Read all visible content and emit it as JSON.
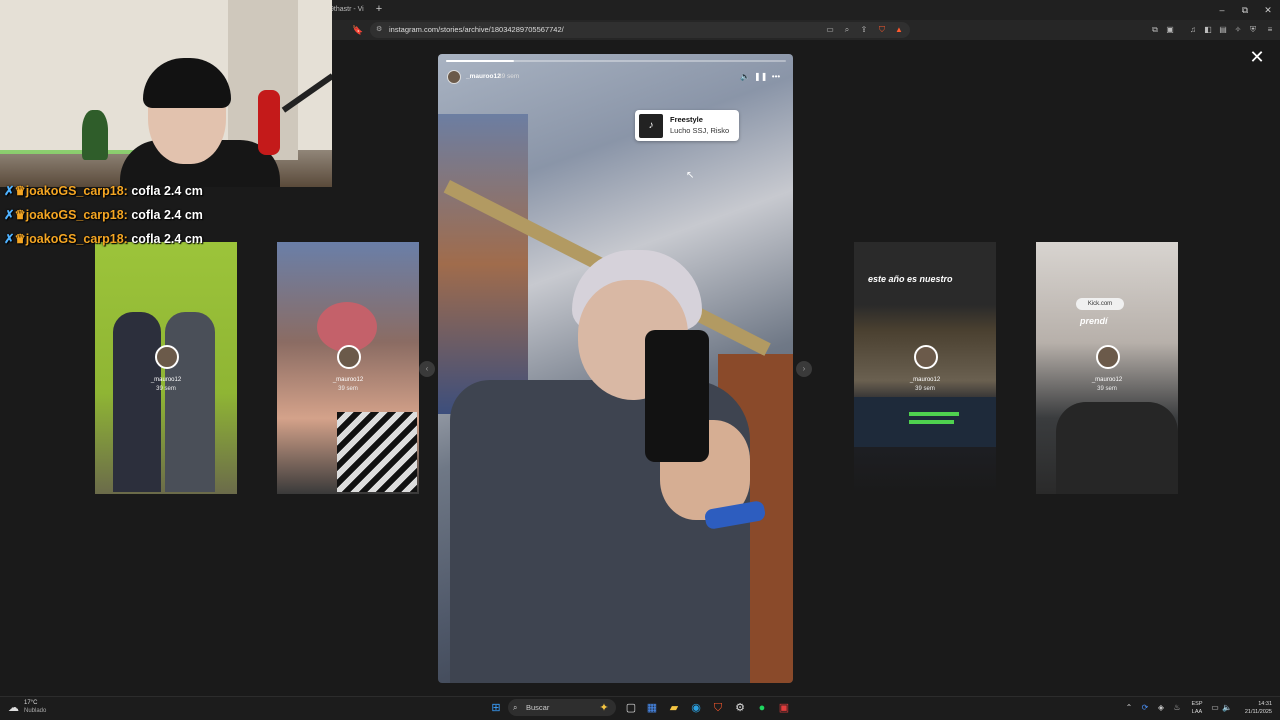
{
  "browser": {
    "tab_title": "9thastr - Vi",
    "new_tab": "+",
    "url": "instagram.com/stories/archive/18034289705567742/",
    "window_controls": [
      "–",
      "⧉",
      "✕"
    ]
  },
  "viewer": {
    "close_label": "✕",
    "prev_arrow": "‹",
    "next_arrow": "›"
  },
  "story": {
    "username": "_mauroo12",
    "time": "39 sem",
    "progress": 0.2,
    "music": {
      "title": "Freestyle",
      "artist": "Lucho SSJ, Risko"
    }
  },
  "thumbnails": [
    {
      "username": "_mauroo12",
      "time": "39 sem",
      "caption": ""
    },
    {
      "username": "_mauroo12",
      "time": "39 sem",
      "caption": ""
    },
    {
      "username": "_mauroo12",
      "time": "39 sem",
      "caption": "este año es nuestro"
    },
    {
      "username": "_mauroo12",
      "time": "39 sem",
      "caption": "prendí"
    }
  ],
  "chat": [
    {
      "user": "joakoGS_carp18:",
      "message": "cofla 2.4 cm"
    },
    {
      "user": "joakoGS_carp18:",
      "message": "cofla 2.4 cm"
    },
    {
      "user": "joakoGS_carp18:",
      "message": "cofla 2.4 cm"
    }
  ],
  "taskbar": {
    "weather_temp": "17°C",
    "weather_desc": "Nublado",
    "search_label": "Buscar",
    "lang_top": "ESP",
    "lang_bottom": "LAA",
    "time": "14:31",
    "date": "21/11/2025"
  }
}
